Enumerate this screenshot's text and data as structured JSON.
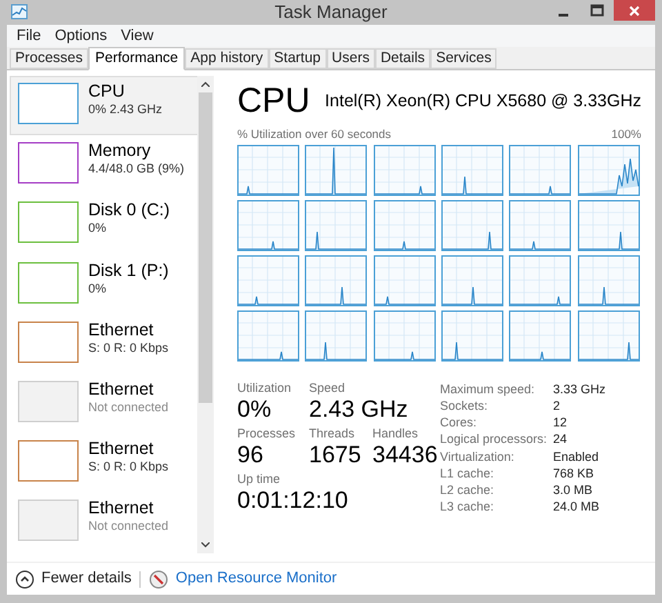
{
  "window": {
    "title": "Task Manager"
  },
  "menu": [
    "File",
    "Options",
    "View"
  ],
  "tabs": [
    {
      "label": "Processes",
      "selected": false
    },
    {
      "label": "Performance",
      "selected": true
    },
    {
      "label": "App history",
      "selected": false
    },
    {
      "label": "Startup",
      "selected": false
    },
    {
      "label": "Users",
      "selected": false
    },
    {
      "label": "Details",
      "selected": false
    },
    {
      "label": "Services",
      "selected": false
    }
  ],
  "sidebar": {
    "items": [
      {
        "name": "CPU",
        "detail": "0% 2.43 GHz",
        "color": "#4ba0d6",
        "selected": true,
        "connected": true
      },
      {
        "name": "Memory",
        "detail": "4.4/48.0 GB (9%)",
        "color": "#a53ec5",
        "selected": false,
        "connected": true
      },
      {
        "name": "Disk 0 (C:)",
        "detail": "0%",
        "color": "#6cbf3f",
        "selected": false,
        "connected": true
      },
      {
        "name": "Disk 1 (P:)",
        "detail": "0%",
        "color": "#6cbf3f",
        "selected": false,
        "connected": true
      },
      {
        "name": "Ethernet",
        "detail": "S: 0 R: 0 Kbps",
        "color": "#c8834a",
        "selected": false,
        "connected": true
      },
      {
        "name": "Ethernet",
        "detail": "Not connected",
        "color": "#cfcfcf",
        "selected": false,
        "connected": false
      },
      {
        "name": "Ethernet",
        "detail": "S: 0 R: 0 Kbps",
        "color": "#c8834a",
        "selected": false,
        "connected": true
      },
      {
        "name": "Ethernet",
        "detail": "Not connected",
        "color": "#cfcfcf",
        "selected": false,
        "connected": false
      }
    ]
  },
  "main": {
    "title": "CPU",
    "model": "Intel(R) Xeon(R) CPU X5680 @ 3.33GHz",
    "graph_caption": "% Utilization over 60 seconds",
    "graph_max": "100%",
    "stats": [
      {
        "label": "Utilization",
        "value": "0%"
      },
      {
        "label": "Speed",
        "value": "2.43 GHz"
      },
      {
        "label": "Processes",
        "value": "96"
      },
      {
        "label": "Threads",
        "value": "1675"
      },
      {
        "label": "Handles",
        "value": "34436"
      },
      {
        "label": "Up time",
        "value": "0:01:12:10"
      }
    ],
    "specs": [
      {
        "label": "Maximum speed:",
        "value": "3.33 GHz"
      },
      {
        "label": "Sockets:",
        "value": "2"
      },
      {
        "label": "Cores:",
        "value": "12"
      },
      {
        "label": "Logical processors:",
        "value": "24"
      },
      {
        "label": "Virtualization:",
        "value": "Enabled"
      },
      {
        "label": "L1 cache:",
        "value": "768 KB"
      },
      {
        "label": "L2 cache:",
        "value": "3.0 MB"
      },
      {
        "label": "L3 cache:",
        "value": "24.0 MB"
      }
    ]
  },
  "footer": {
    "fewer_details": "Fewer details",
    "resource_monitor": "Open Resource Monitor"
  }
}
